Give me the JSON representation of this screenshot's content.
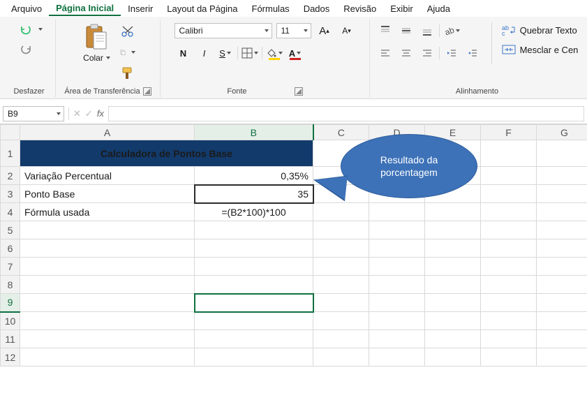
{
  "menubar": {
    "items": [
      "Arquivo",
      "Página Inicial",
      "Inserir",
      "Layout da Página",
      "Fórmulas",
      "Dados",
      "Revisão",
      "Exibir",
      "Ajuda"
    ],
    "active_index": 1
  },
  "ribbon": {
    "undo_group_label": "Desfazer",
    "clipboard": {
      "paste_label": "Colar",
      "group_label": "Área de Transferência"
    },
    "font": {
      "name": "Calibri",
      "size": "11",
      "bold_glyph": "N",
      "italic_glyph": "I",
      "underline_glyph": "S",
      "font_color": "#d02020",
      "fill_color": "#ffd400",
      "grow_glyph": "A",
      "shrink_glyph": "A",
      "group_label": "Fonte"
    },
    "alignment": {
      "wrap_label": "Quebrar Texto",
      "merge_label": "Mesclar e Cen",
      "group_label": "Alinhamento"
    }
  },
  "namebar": {
    "cell_ref": "B9",
    "fx_label": "fx",
    "formula_value": ""
  },
  "grid": {
    "columns": [
      "A",
      "B",
      "C",
      "D",
      "E",
      "F",
      "G"
    ],
    "rows": [
      "1",
      "2",
      "3",
      "4",
      "5",
      "6",
      "7",
      "8",
      "9",
      "10",
      "11",
      "12"
    ],
    "title": "Calculadora de Pontos Base",
    "r2": {
      "label": "Variação Percentual",
      "value": "0,35%"
    },
    "r3": {
      "label": "Ponto Base",
      "value": "35"
    },
    "r4": {
      "label": "Fórmula usada",
      "value": "=(B2*100)*100"
    },
    "active_cell": "B9",
    "active_row_index": 8,
    "active_col_index": 1
  },
  "callout": {
    "line1": "Resultado da",
    "line2": "porcentagem"
  }
}
